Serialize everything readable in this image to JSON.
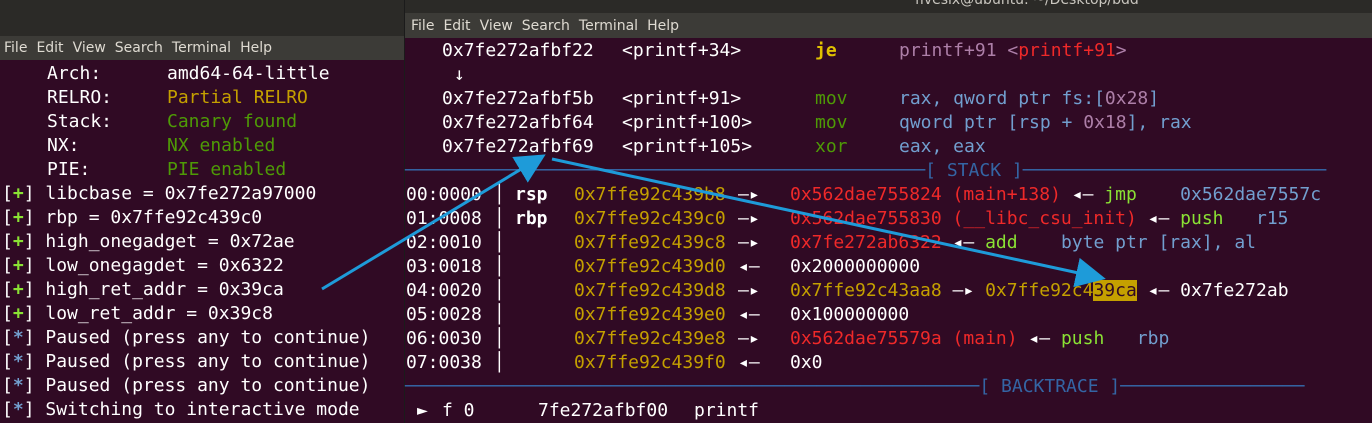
{
  "left": {
    "menu": [
      "File",
      "Edit",
      "View",
      "Search",
      "Terminal",
      "Help"
    ],
    "checksec": [
      {
        "key": "Arch:",
        "value": "amd64-64-little",
        "color": "#ffffff"
      },
      {
        "key": "RELRO:",
        "value": "Partial RELRO",
        "color": "#c4a000"
      },
      {
        "key": "Stack:",
        "value": "Canary found",
        "color": "#4e9a06"
      },
      {
        "key": "NX:",
        "value": "NX enabled",
        "color": "#4e9a06"
      },
      {
        "key": "PIE:",
        "value": "PIE enabled",
        "color": "#4e9a06"
      }
    ],
    "log": [
      {
        "tag": "+",
        "text": "libcbase = 0x7fe272a97000"
      },
      {
        "tag": "+",
        "text": "rbp = 0x7ffe92c439c0"
      },
      {
        "tag": "+",
        "text": "high_onegadget = 0x72ae"
      },
      {
        "tag": "+",
        "text": "low_onegagdet = 0x6322"
      },
      {
        "tag": "+",
        "text": "high_ret_addr = 0x39ca"
      },
      {
        "tag": "+",
        "text": "low_ret_addr = 0x39c8"
      },
      {
        "tag": "*",
        "text": "Paused (press any to continue)"
      },
      {
        "tag": "*",
        "text": "Paused (press any to continue)"
      },
      {
        "tag": "*",
        "text": "Paused (press any to continue)"
      },
      {
        "tag": "*",
        "text": "Switching to interactive mode"
      }
    ]
  },
  "right": {
    "title": "fivesix@ubuntu: ~/Desktop/bdd",
    "menu": [
      "File",
      "Edit",
      "View",
      "Search",
      "Terminal",
      "Help"
    ],
    "disasm": [
      {
        "addr": "0x7fe272afbf22",
        "sym": "<printf+34>",
        "op": "je",
        "args": "printf+91 <printf+91>"
      },
      {
        "addr": "0x7fe272afbf5b",
        "sym": "<printf+91>",
        "op": "mov",
        "args": "rax, qword ptr fs:[0x28]"
      },
      {
        "addr": "0x7fe272afbf64",
        "sym": "<printf+100>",
        "op": "mov",
        "args": "qword ptr [rsp + 0x18], rax"
      },
      {
        "addr": "0x7fe272afbf69",
        "sym": "<printf+105>",
        "op": "xor",
        "args": "eax, eax"
      }
    ],
    "down_arrow": "↓",
    "stack_header": "[ STACK ]",
    "stack": [
      {
        "off": "00:0000",
        "reg": "rsp",
        "addr": "0x7ffe92c439b8",
        "arrow": "—▸",
        "val": "0x562dae755824 (main+138)",
        "tail": "◂— jmp    0x562dae7557c"
      },
      {
        "off": "01:0008",
        "reg": "rbp",
        "addr": "0x7ffe92c439c0",
        "arrow": "—▸",
        "val": "0x562dae755830 (__libc_csu_init)",
        "tail": "◂— push   r15"
      },
      {
        "off": "02:0010",
        "reg": "",
        "addr": "0x7ffe92c439c8",
        "arrow": "—▸",
        "val": "0x7fe272ab6322",
        "tail": "◂— add    byte ptr [rax], al"
      },
      {
        "off": "03:0018",
        "reg": "",
        "addr": "0x7ffe92c439d0",
        "arrow": "◂—",
        "val": "0x2000000000",
        "tail": ""
      },
      {
        "off": "04:0020",
        "reg": "",
        "addr": "0x7ffe92c439d8",
        "arrow": "—▸",
        "val": "0x7ffe92c43aa8 —▸ 0x7ffe92c4",
        "hl": "39ca",
        "tail": "◂— 0x7fe272ab"
      },
      {
        "off": "05:0028",
        "reg": "",
        "addr": "0x7ffe92c439e0",
        "arrow": "◂—",
        "val": "0x100000000",
        "tail": ""
      },
      {
        "off": "06:0030",
        "reg": "",
        "addr": "0x7ffe92c439e8",
        "arrow": "—▸",
        "val": "0x562dae75579a (main)",
        "tail": "◂— push   rbp"
      },
      {
        "off": "07:0038",
        "reg": "",
        "addr": "0x7ffe92c439f0",
        "arrow": "◂—",
        "val": "0x0",
        "tail": ""
      }
    ],
    "backtrace_header": "[ BACKTRACE ]",
    "backtrace": {
      "marker": "►",
      "frame": "f 0",
      "addr": "7fe272afbf00",
      "func": "printf"
    }
  },
  "annotation_color": "#1e9bd9"
}
